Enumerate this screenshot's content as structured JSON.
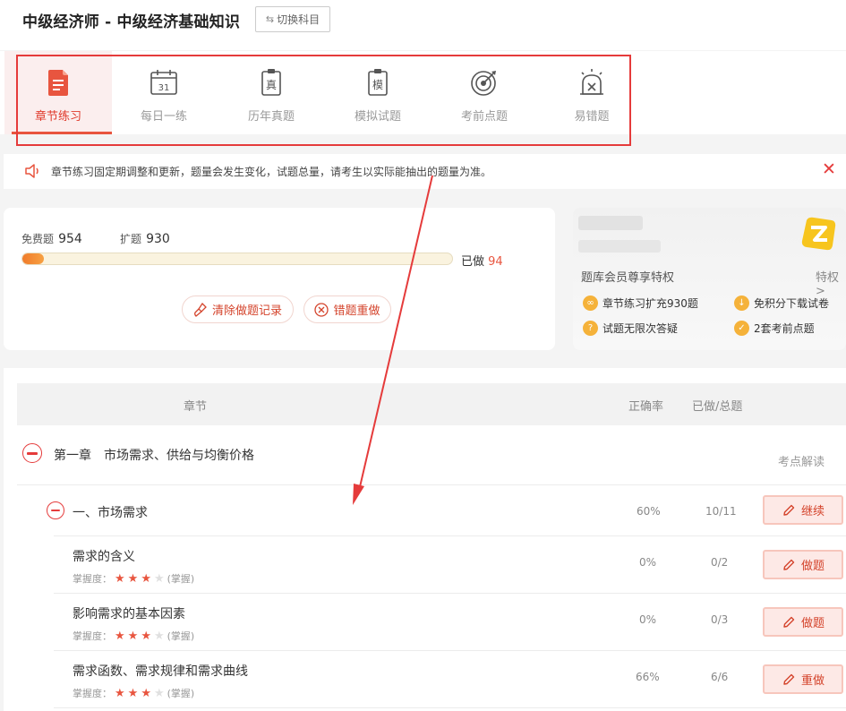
{
  "header": {
    "title": "中级经济师 - 中级经济基础知识",
    "switch_label": "切换科目"
  },
  "tabs": [
    {
      "label": "章节练习",
      "icon": "chapter-practice-icon",
      "active": true
    },
    {
      "label": "每日一练",
      "icon": "calendar-icon",
      "day": "31"
    },
    {
      "label": "历年真题",
      "icon": "past-exam-icon",
      "glyph": "真"
    },
    {
      "label": "模拟试题",
      "icon": "mock-exam-icon",
      "glyph": "模"
    },
    {
      "label": "考前点题",
      "icon": "target-icon"
    },
    {
      "label": "易错题",
      "icon": "alarm-icon"
    }
  ],
  "notice": {
    "text": "章节练习固定期调整和更新，题量会发生变化，试题总量，请考生以实际能抽出的题量为准。"
  },
  "stats": {
    "free_label": "免费题",
    "free_count": "954",
    "ext_label": "扩题",
    "ext_count": "930",
    "done_label": "已做",
    "done_count": "94",
    "progress_fraction": 0.05,
    "clear_label": "清除做题记录",
    "redo_label": "错题重做"
  },
  "member": {
    "title": "题库会员尊享特权",
    "more": "特权>",
    "items": [
      "章节练习扩充930题",
      "免积分下载试卷",
      "试题无限次答疑",
      "2套考前点题"
    ]
  },
  "table": {
    "col_chapter": "章节",
    "col_rate": "正确率",
    "col_done": "已做/总题",
    "chapter": {
      "title": "第一章　市场需求、供给与均衡价格",
      "action": "考点解读"
    },
    "section": {
      "title": "一、市场需求",
      "rate": "60%",
      "done": "10/11",
      "action": "继续"
    },
    "mastery_label": "掌握度：",
    "mastery_state": "(掌握)",
    "items": [
      {
        "title": "需求的含义",
        "rate": "0%",
        "done": "0/2",
        "action": "做题",
        "stars": 3
      },
      {
        "title": "影响需求的基本因素",
        "rate": "0%",
        "done": "0/3",
        "action": "做题",
        "stars": 3
      },
      {
        "title": "需求函数、需求规律和需求曲线",
        "rate": "66%",
        "done": "6/6",
        "action": "重做",
        "stars": 3
      }
    ]
  },
  "colors": {
    "accent": "#e8553f",
    "annotation_red": "#e53b3b"
  }
}
